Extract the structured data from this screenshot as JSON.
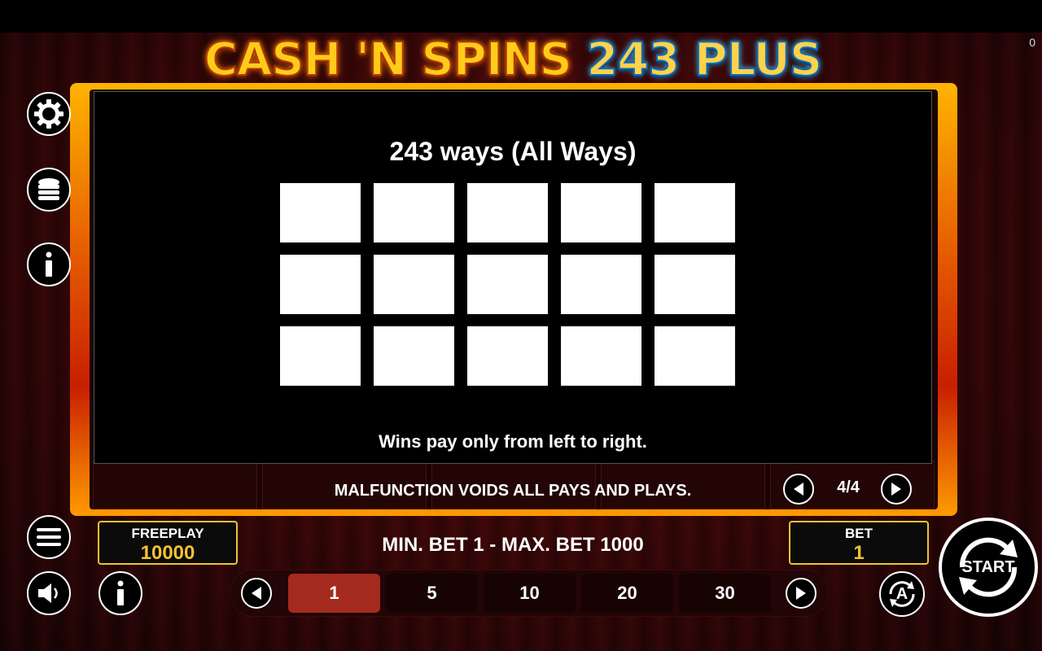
{
  "corner_counter": "0",
  "logo": {
    "part1": "CASH 'N SPINS",
    "part2": "243 PLUS"
  },
  "info_panel": {
    "title": "243 ways (All Ways)",
    "footer": "Wins pay only from left to right.",
    "grid": {
      "rows": 3,
      "cols": 5
    }
  },
  "disclaimer": "MALFUNCTION VOIDS ALL PAYS AND PLAYS.",
  "pagination": {
    "indicator": "4/4"
  },
  "freeplay": {
    "label": "FREEPLAY",
    "value": "10000"
  },
  "bet": {
    "label": "BET",
    "value": "1"
  },
  "bet_limits": "MIN. BET 1 - MAX. BET 1000",
  "bet_options": [
    {
      "label": "1",
      "selected": true
    },
    {
      "label": "5",
      "selected": false
    },
    {
      "label": "10",
      "selected": false
    },
    {
      "label": "20",
      "selected": false
    },
    {
      "label": "30",
      "selected": false
    }
  ],
  "start_label": "START",
  "auto_label": "A",
  "icons": {
    "settings": "gear-icon",
    "coins": "coin-stack-icon",
    "info": "info-icon",
    "menu": "hamburger-menu-icon",
    "sound": "speaker-icon"
  },
  "colors": {
    "frame": "#e55a00",
    "gold": "#f2c230",
    "active_bet": "#a52a1e"
  }
}
